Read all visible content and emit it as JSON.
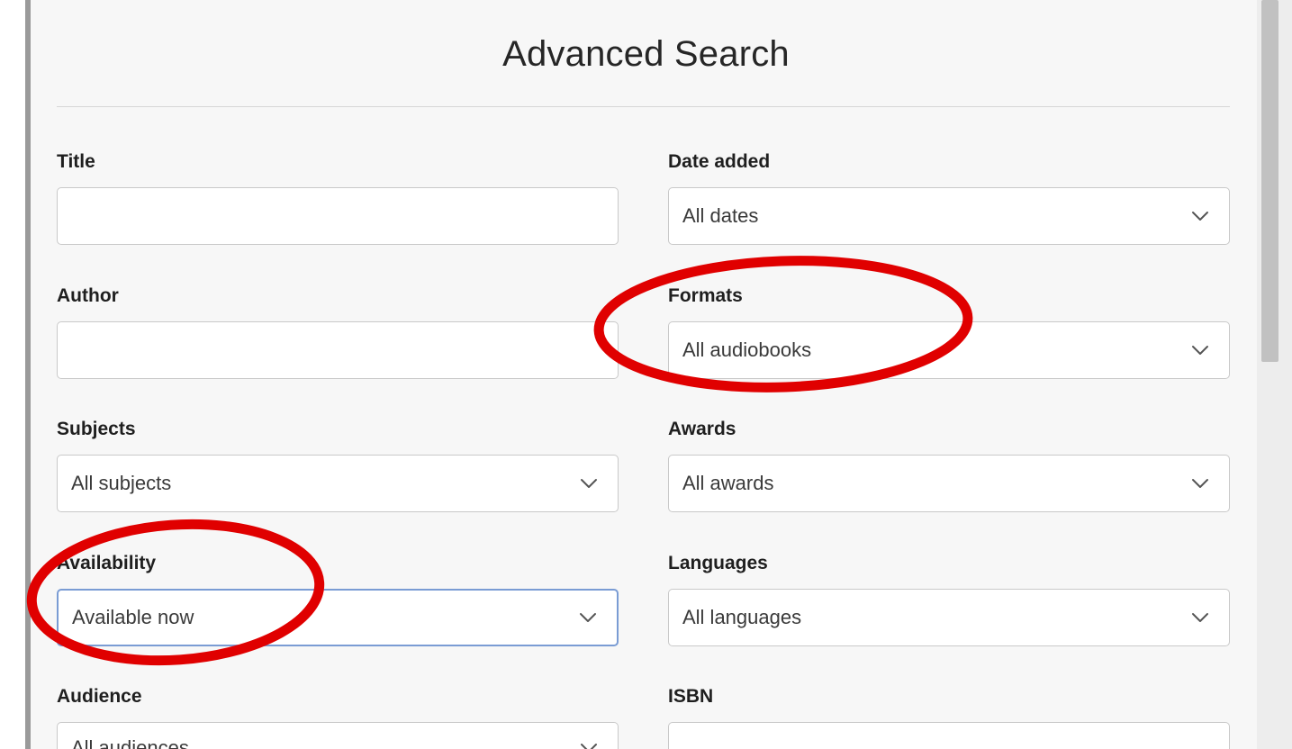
{
  "header": {
    "title": "Advanced Search"
  },
  "form": {
    "title": {
      "label": "Title",
      "value": ""
    },
    "date_added": {
      "label": "Date added",
      "value": "All dates"
    },
    "author": {
      "label": "Author",
      "value": ""
    },
    "formats": {
      "label": "Formats",
      "value": "All audiobooks"
    },
    "subjects": {
      "label": "Subjects",
      "value": "All subjects"
    },
    "awards": {
      "label": "Awards",
      "value": "All awards"
    },
    "availability": {
      "label": "Availability",
      "value": "Available now"
    },
    "languages": {
      "label": "Languages",
      "value": "All languages"
    },
    "audience": {
      "label": "Audience",
      "value": "All audiences"
    },
    "isbn": {
      "label": "ISBN",
      "value": ""
    }
  },
  "icons": {
    "dropdown": "chevron-down-icon"
  },
  "colors": {
    "annotation": "#e00000",
    "focus_border": "#7a9cd4",
    "panel_background": "#f7f7f7"
  }
}
